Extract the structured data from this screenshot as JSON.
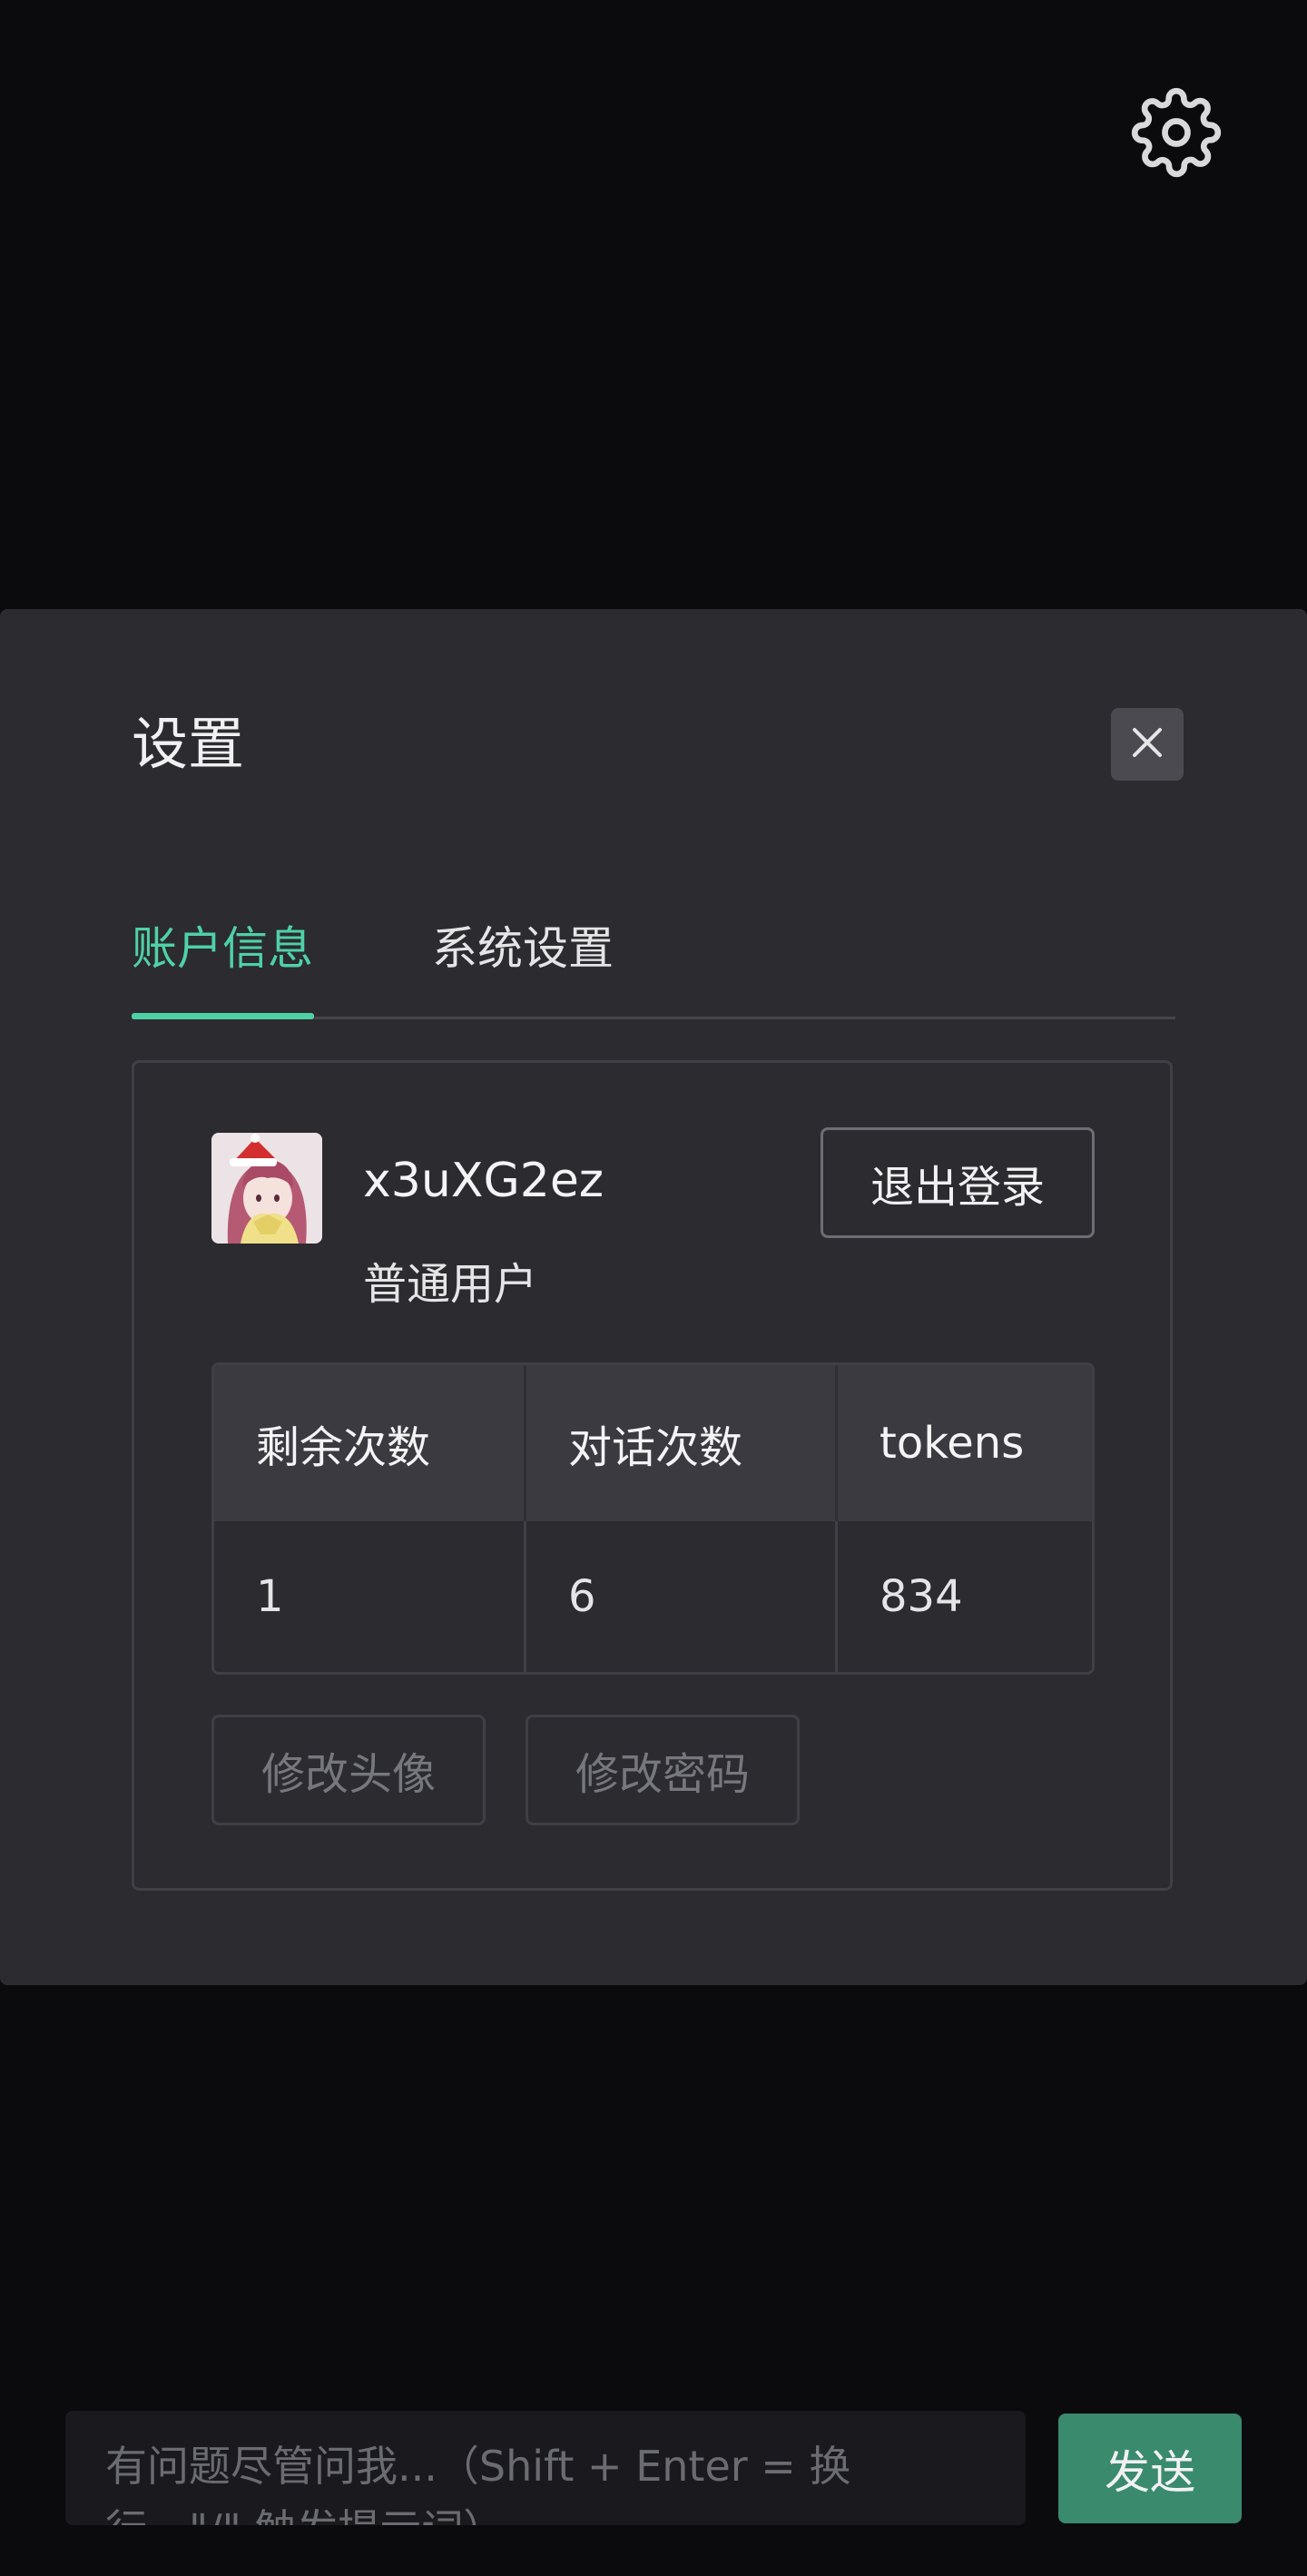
{
  "settings_icon": "gear-icon",
  "modal": {
    "title": "设置",
    "close_icon": "close-icon",
    "tabs": [
      {
        "label": "账户信息",
        "active": true
      },
      {
        "label": "系统设置",
        "active": false
      }
    ],
    "account": {
      "avatar_icon": "avatar",
      "username": "x3uXG2ez",
      "role": "普通用户",
      "logout_label": "退出登录",
      "stats": {
        "headers": [
          "剩余次数",
          "对话次数",
          "tokens"
        ],
        "values": [
          "1",
          "6",
          "834"
        ]
      },
      "change_avatar_label": "修改头像",
      "change_password_label": "修改密码"
    }
  },
  "chat": {
    "placeholder": "有问题尽管问我...（Shift + Enter = 换行，\"/\" 触发提示词）",
    "send_label": "发送"
  },
  "colors": {
    "accent": "#4fd1a6",
    "send_button": "#3a8a6e",
    "background": "#0b0b0e",
    "modal": "#2b2b30"
  }
}
